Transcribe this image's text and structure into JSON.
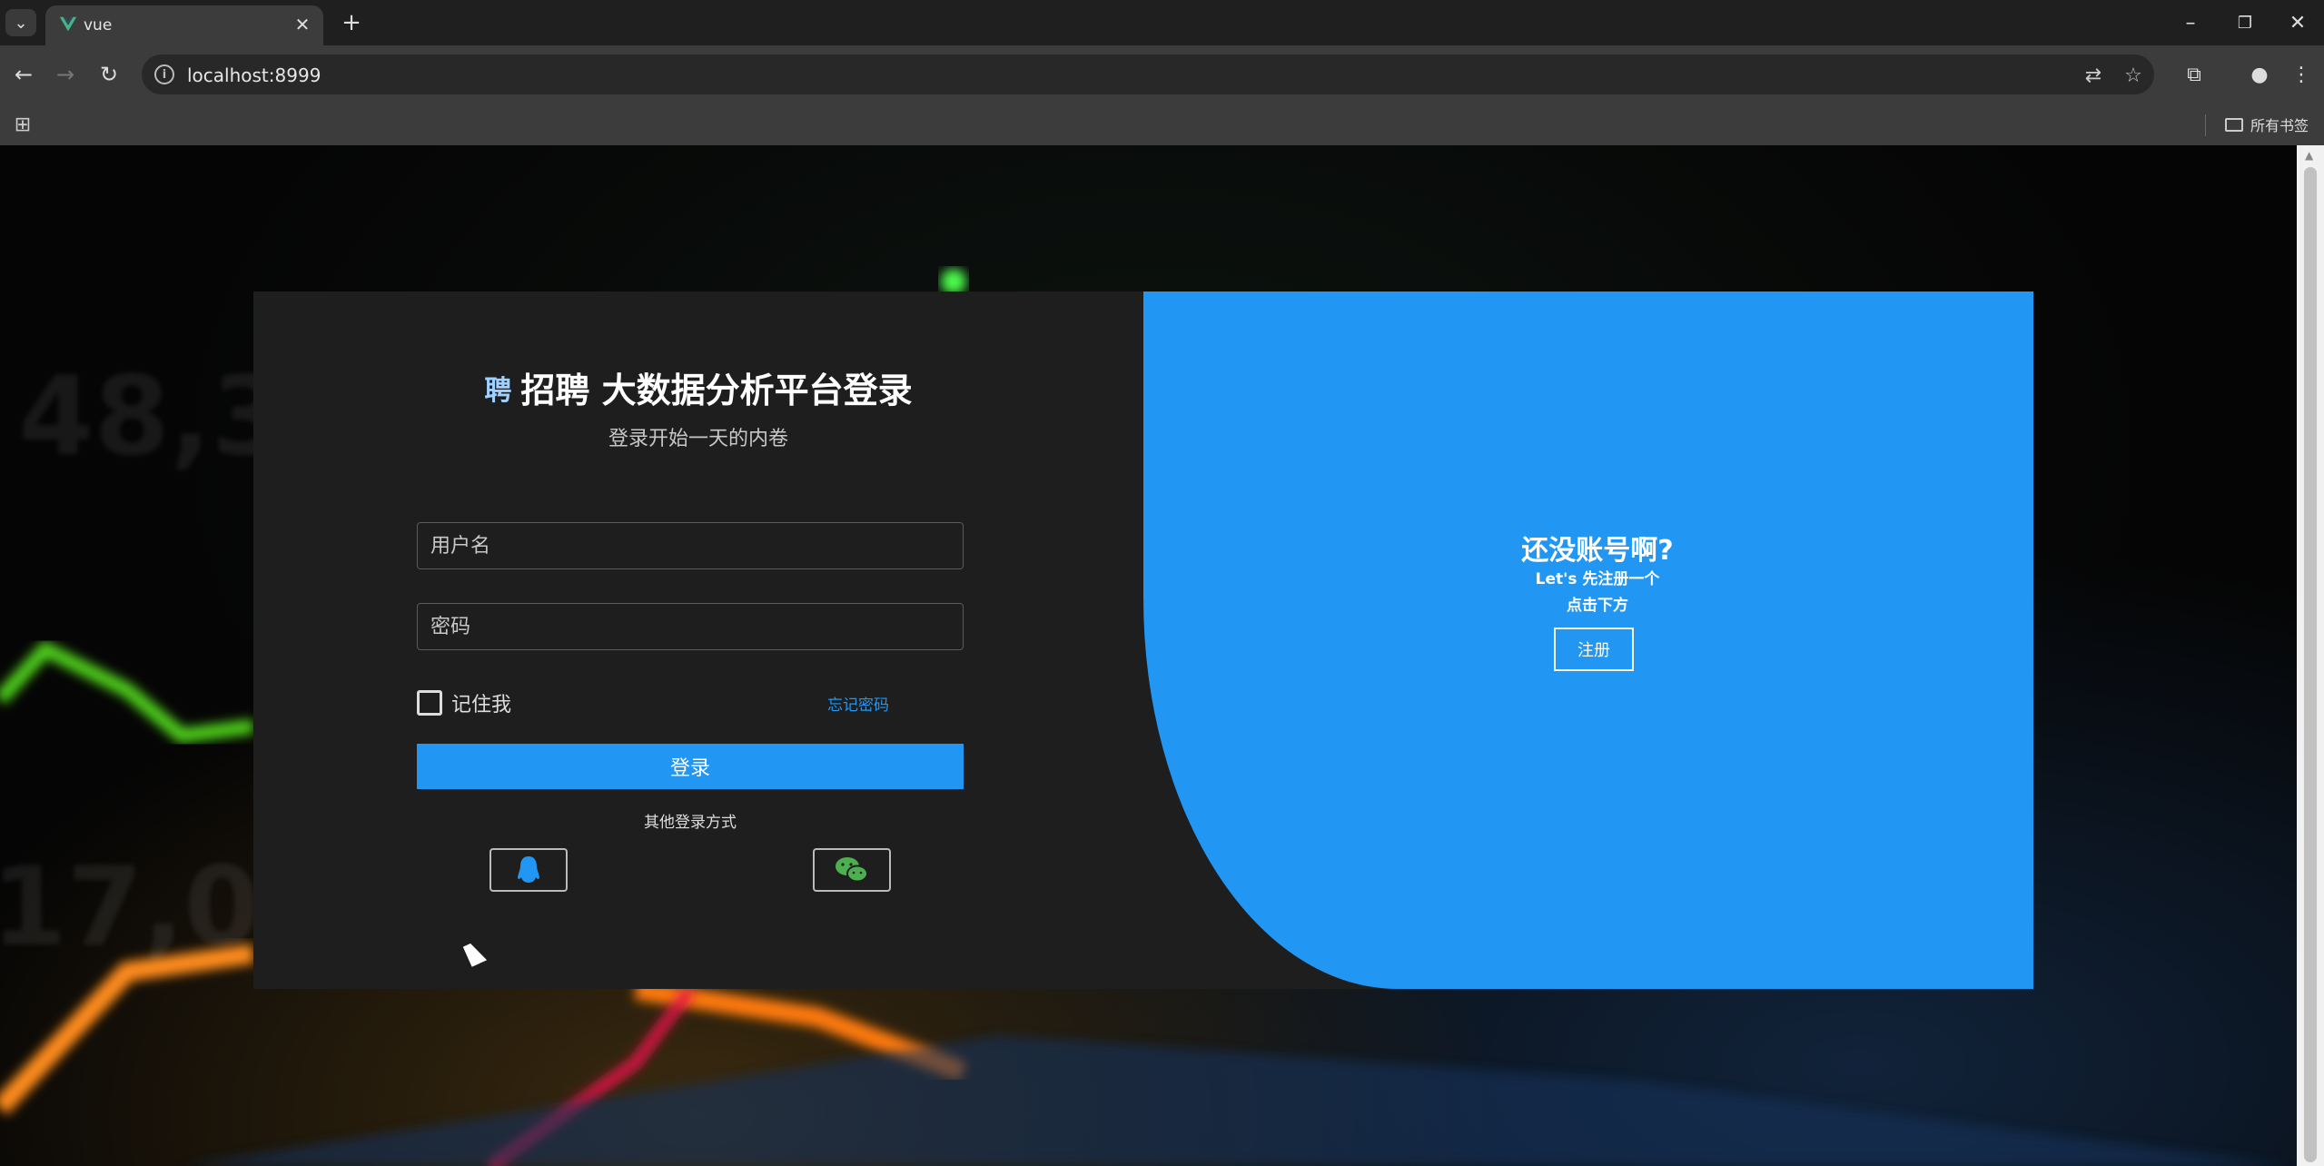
{
  "browser": {
    "tab_title": "vue",
    "url": "localhost:8999",
    "bookmarks_label": "所有书签"
  },
  "login": {
    "logo_char": "聘",
    "title": "招聘 大数据分析平台登录",
    "subtitle": "登录开始一天的内卷",
    "username_placeholder": "用户名",
    "password_placeholder": "密码",
    "remember_label": "记住我",
    "forgot_label": "忘记密码",
    "login_button": "登录",
    "other_methods": "其他登录方式"
  },
  "register": {
    "title": "还没账号啊?",
    "line1": "Let's 先注册一个",
    "line2": "点击下方",
    "button": "注册"
  },
  "colors": {
    "accent": "#2196f3",
    "card_bg": "#1e1e1e",
    "wechat": "#4caf50"
  },
  "icons": [
    "qq-icon",
    "wechat-icon"
  ]
}
